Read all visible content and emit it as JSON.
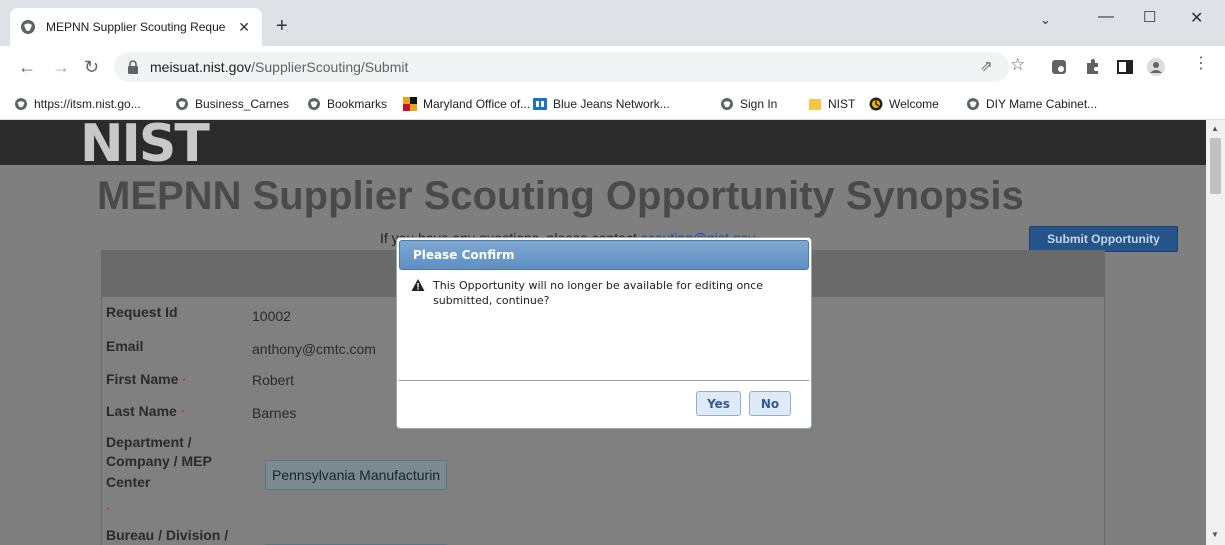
{
  "browser": {
    "tab_title": "MEPNN Supplier Scouting Reque",
    "tab_close": "✕",
    "new_tab": "+",
    "url_host": "meisuat.nist.gov",
    "url_path": "/SupplierScouting/Submit"
  },
  "bookmarks": [
    {
      "label": "https://itsm.nist.go..."
    },
    {
      "label": "Business_Carnes"
    },
    {
      "label": "Bookmarks"
    },
    {
      "label": "Maryland Office of..."
    },
    {
      "label": "Blue Jeans Network..."
    },
    {
      "label": "Sign In"
    },
    {
      "label": "NIST"
    },
    {
      "label": "Welcome"
    },
    {
      "label": "DIY Mame Cabinet..."
    }
  ],
  "page": {
    "logo": "NIST",
    "title": "MEPNN Supplier Scouting Opportunity Synopsis",
    "contact_prefix": "If you have any questions, please contact ",
    "contact_email": "scouting@nist.gov",
    "submit_button": "Submit Opportunity",
    "fields": {
      "request_id_label": "Request Id",
      "request_id_value": "10002",
      "email_label": "Email",
      "email_value": "anthony@cmtc.com",
      "first_name_label": "First Name",
      "first_name_value": "Robert",
      "last_name_label": "Last Name",
      "last_name_value": "Barnes",
      "department_label_1": "Department /",
      "department_label_2": "Company / MEP",
      "department_label_3": "Center",
      "department_value": "Pennsylvania Manufacturin",
      "bureau_label": "Bureau / Division /",
      "required_marker": "·"
    }
  },
  "dialog": {
    "title": "Please Confirm",
    "message": "This Opportunity will no longer be available for editing once submitted, continue?",
    "yes_label": "Yes",
    "no_label": "No"
  }
}
